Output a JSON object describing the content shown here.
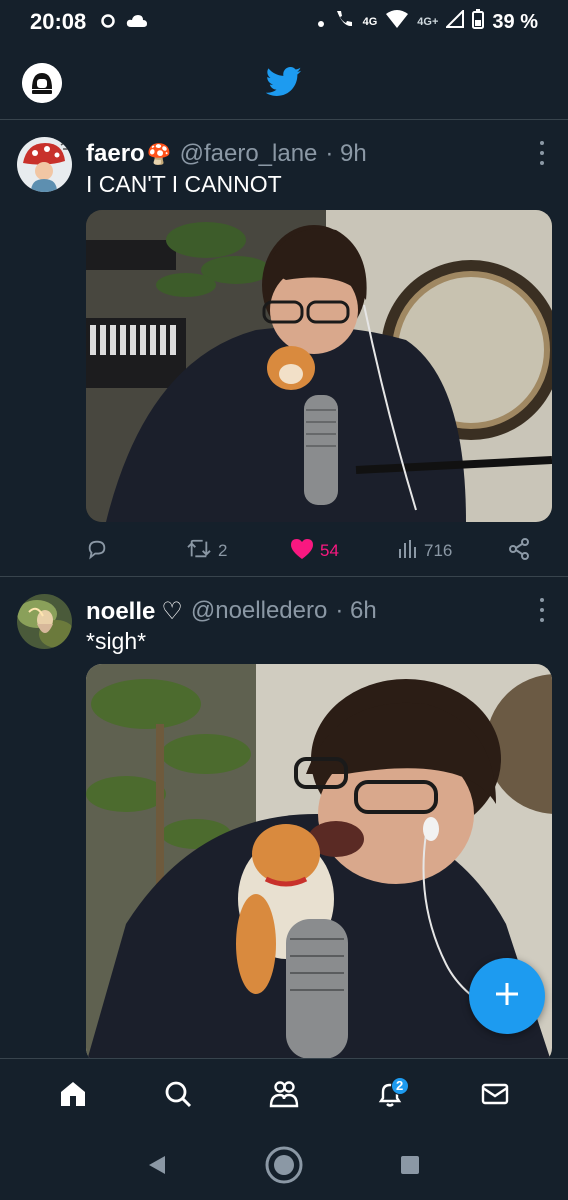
{
  "status_bar": {
    "time": "20:08",
    "network_a": "4G",
    "network_b": "4G+",
    "battery": "39 %"
  },
  "tweets": [
    {
      "name": "faero",
      "name_emoji": "🍄",
      "handle": "@faero_lane",
      "time": "· 9h",
      "text": "I CAN'T I CANNOT",
      "replies": "",
      "retweets": "2",
      "likes": "54",
      "views": "716"
    },
    {
      "name": "noelle",
      "name_emoji": "♡",
      "handle": "@noelledero",
      "time": "· 6h",
      "text": "*sigh*"
    }
  ],
  "bottom_nav": {
    "notifications_badge": "2"
  },
  "colors": {
    "background": "#15202b",
    "accent": "#1d9bf0",
    "like": "#f91880",
    "muted": "#8b98a5",
    "divider": "#38444d"
  },
  "icons": [
    "cloud-icon",
    "wifi-icon",
    "call-icon",
    "signal-icon",
    "battery-icon",
    "twitter-bird-icon",
    "reply-icon",
    "retweet-icon",
    "heart-icon",
    "views-icon",
    "share-icon",
    "more-icon",
    "compose-plus-icon",
    "home-icon",
    "search-icon",
    "communities-icon",
    "bell-icon",
    "mail-icon",
    "back-icon",
    "home-circle-icon",
    "recents-icon"
  ]
}
